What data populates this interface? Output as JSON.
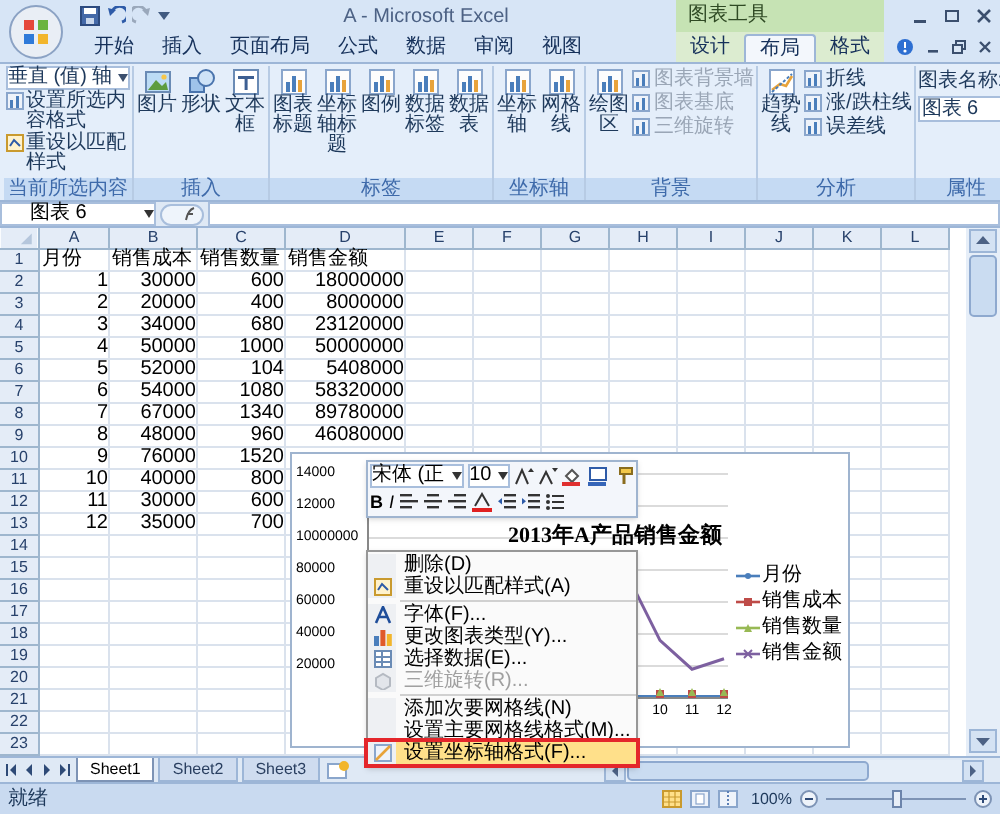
{
  "window": {
    "title": "A - Microsoft Excel"
  },
  "tabs": [
    {
      "label": "开始",
      "selected": false
    },
    {
      "label": "插入",
      "selected": false
    },
    {
      "label": "页面布局",
      "selected": false
    },
    {
      "label": "公式",
      "selected": false
    },
    {
      "label": "数据",
      "selected": false
    },
    {
      "label": "审阅",
      "selected": false
    },
    {
      "label": "视图",
      "selected": false
    }
  ],
  "chart_tools": {
    "label": "图表工具",
    "tabs": [
      {
        "label": "设计",
        "selected": false
      },
      {
        "label": "布局",
        "selected": true
      },
      {
        "label": "格式",
        "selected": false
      }
    ]
  },
  "ribbon": [
    {
      "kind": "selection",
      "label": "当前所选内容",
      "dropdown": "垂直 (值) 轴",
      "items": [
        "设置所选内容格式",
        "重设以匹配样式"
      ]
    },
    {
      "kind": "large",
      "label": "插入",
      "buttons": [
        "图片",
        "形状",
        "文本框"
      ]
    },
    {
      "kind": "large",
      "label": "标签",
      "buttons": [
        "图表标题",
        "坐标轴标题",
        "图例",
        "数据标签",
        "数据表"
      ]
    },
    {
      "kind": "large",
      "label": "坐标轴",
      "buttons": [
        "坐标轴",
        "网格线"
      ]
    },
    {
      "kind": "mixed",
      "label": "背景",
      "buttons": [
        "绘图区"
      ],
      "items": [
        {
          "label": "图表背景墙",
          "disabled": true
        },
        {
          "label": "图表基底",
          "disabled": true
        },
        {
          "label": "三维旋转",
          "disabled": true
        }
      ]
    },
    {
      "kind": "mixed",
      "label": "分析",
      "buttons": [
        "趋势线"
      ],
      "items": [
        {
          "label": "折线",
          "disabled": false
        },
        {
          "label": "涨/跌柱线",
          "disabled": false
        },
        {
          "label": "误差线",
          "disabled": false
        }
      ]
    },
    {
      "kind": "name",
      "label": "属性",
      "field_label": "图表名称:",
      "value": "图表 6"
    }
  ],
  "formula_bar": {
    "name_box": "图表 6"
  },
  "sheet": {
    "columns": [
      "A",
      "B",
      "C",
      "D",
      "E",
      "F",
      "G",
      "H",
      "I",
      "J",
      "K",
      "L"
    ],
    "rows": [
      {
        "number": "1",
        "kind": "text",
        "cells": [
          "月份",
          "销售成本",
          "销售数量",
          "销售金额"
        ]
      },
      {
        "number": "2",
        "kind": "number",
        "cells": [
          "1",
          "30000",
          "600",
          "18000000"
        ]
      },
      {
        "number": "3",
        "kind": "number",
        "cells": [
          "2",
          "20000",
          "400",
          "8000000"
        ]
      },
      {
        "number": "4",
        "kind": "number",
        "cells": [
          "3",
          "34000",
          "680",
          "23120000"
        ]
      },
      {
        "number": "5",
        "kind": "number",
        "cells": [
          "4",
          "50000",
          "1000",
          "50000000"
        ]
      },
      {
        "number": "6",
        "kind": "number",
        "cells": [
          "5",
          "52000",
          "104",
          "5408000"
        ]
      },
      {
        "number": "7",
        "kind": "number",
        "cells": [
          "6",
          "54000",
          "1080",
          "58320000"
        ]
      },
      {
        "number": "8",
        "kind": "number",
        "cells": [
          "7",
          "67000",
          "1340",
          "89780000"
        ]
      },
      {
        "number": "9",
        "kind": "number",
        "cells": [
          "8",
          "48000",
          "960",
          "46080000"
        ]
      },
      {
        "number": "10",
        "kind": "number",
        "cells": [
          "9",
          "76000",
          "1520"
        ]
      },
      {
        "number": "11",
        "kind": "number",
        "cells": [
          "10",
          "40000",
          "800"
        ]
      },
      {
        "number": "12",
        "kind": "number",
        "cells": [
          "11",
          "30000",
          "600"
        ]
      },
      {
        "number": "13",
        "kind": "number",
        "cells": [
          "12",
          "35000",
          "700"
        ]
      },
      {
        "number": "14"
      },
      {
        "number": "15"
      },
      {
        "number": "16"
      },
      {
        "number": "17"
      },
      {
        "number": "18"
      },
      {
        "number": "19"
      },
      {
        "number": "20"
      },
      {
        "number": "21"
      },
      {
        "number": "22"
      },
      {
        "number": "23"
      }
    ]
  },
  "chart": {
    "title": "2013年A产品销售金额",
    "y_axis_labels": [
      "14000",
      "12000",
      "10000000",
      "80000",
      "60000",
      "40000",
      "20000"
    ],
    "x_axis_labels": [
      "10",
      "11",
      "12"
    ],
    "legend": [
      {
        "label": "月份",
        "color": "#4a7ebb"
      },
      {
        "label": "销售成本",
        "color": "#be4b48"
      },
      {
        "label": "销售数量",
        "color": "#98b954"
      },
      {
        "label": "销售金额",
        "color": "#7d60a0"
      }
    ]
  },
  "mini_toolbar": {
    "font": "宋体 (正",
    "size": "10",
    "bold": "B",
    "italic": "I"
  },
  "context_menu": [
    {
      "label": "删除(D)",
      "disabled": false,
      "selected": false,
      "separator_after": false
    },
    {
      "label": "重设以匹配样式(A)",
      "disabled": false,
      "selected": false,
      "separator_after": true
    },
    {
      "label": "字体(F)...",
      "disabled": false,
      "selected": false,
      "separator_after": false
    },
    {
      "label": "更改图表类型(Y)...",
      "disabled": false,
      "selected": false,
      "separator_after": false
    },
    {
      "label": "选择数据(E)...",
      "disabled": false,
      "selected": false,
      "separator_after": false
    },
    {
      "label": "三维旋转(R)...",
      "disabled": true,
      "selected": false,
      "separator_after": true
    },
    {
      "label": "添加次要网格线(N)",
      "disabled": false,
      "selected": false,
      "separator_after": false
    },
    {
      "label": "设置主要网格线格式(M)...",
      "disabled": false,
      "selected": false,
      "separator_after": false
    },
    {
      "label": "设置坐标轴格式(F)...",
      "disabled": false,
      "selected": true,
      "separator_after": false
    }
  ],
  "sheet_tabs": [
    {
      "label": "Sheet1",
      "selected": true
    },
    {
      "label": "Sheet2",
      "selected": false
    },
    {
      "label": "Sheet3",
      "selected": false
    }
  ],
  "status_bar": {
    "status": "就绪",
    "zoom": "100%",
    "zoom_slider": {
      "level": 0.5
    }
  }
}
